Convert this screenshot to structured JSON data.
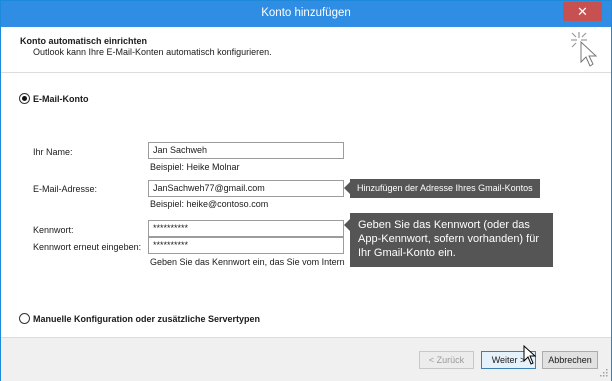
{
  "window": {
    "title": "Konto hinzufügen",
    "close_symbol": "✕"
  },
  "header": {
    "title": "Konto automatisch einrichten",
    "subtitle": "Outlook kann Ihre E-Mail-Konten automatisch konfigurieren.",
    "icon": "magic-wand-cursor-icon"
  },
  "email_option": {
    "label": "E-Mail-Konto",
    "selected": true
  },
  "form": {
    "name_label": "Ihr Name:",
    "name_value": "Jan Sachweh",
    "name_hint": "Beispiel: Heike Molnar",
    "email_label": "E-Mail-Adresse:",
    "email_value": "JanSachweh77@gmail.com",
    "email_hint": "Beispiel: heike@contoso.com",
    "password_label": "Kennwort:",
    "password_value": "**********",
    "password_confirm_label": "Kennwort erneut eingeben:",
    "password_confirm_value": "**********",
    "password_hint": "Geben Sie das Kennwort ein, das Sie vom Intern"
  },
  "callouts": {
    "email": "Hinzufügen der Adresse Ihres Gmail-Kontos",
    "password": "Geben Sie das Kennwort (oder das App-Kennwort, sofern vorhanden) für Ihr Gmail-Konto ein."
  },
  "manual_option": {
    "label": "Manuelle Konfiguration oder zusätzliche Servertypen",
    "selected": false
  },
  "buttons": {
    "back": "< Zurück",
    "next": "Weiter >",
    "cancel": "Abbrechen"
  },
  "colors": {
    "titlebar": "#2f8de4",
    "close_button": "#c75050",
    "callout": "#555555"
  }
}
